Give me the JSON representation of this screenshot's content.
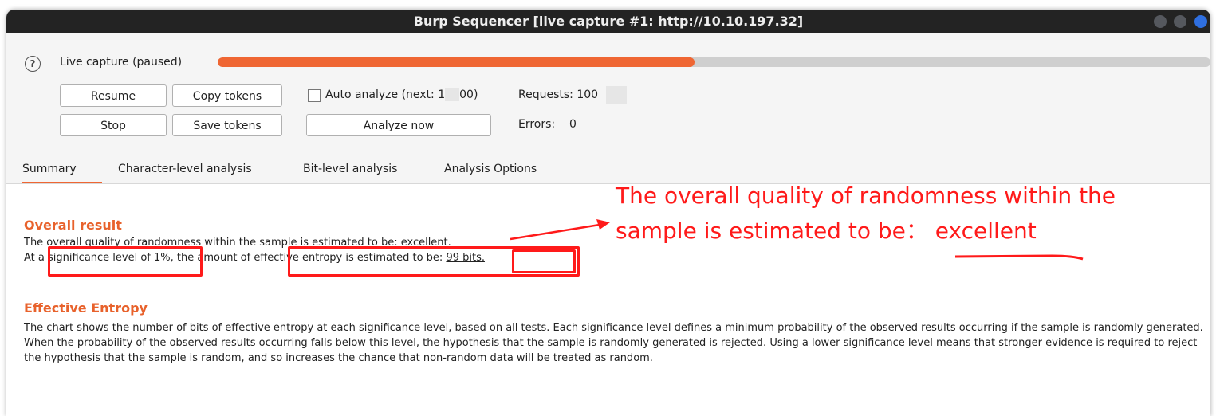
{
  "window": {
    "title": "Burp Sequencer [live capture #1: http://10.10.197.32]"
  },
  "capture": {
    "status": "Live capture (paused)",
    "progress_fraction": 0.48
  },
  "buttons": {
    "resume": "Resume",
    "copy_tokens": "Copy tokens",
    "stop": "Stop",
    "save_tokens": "Save tokens",
    "analyze_now": "Analyze now"
  },
  "auto_analyze": {
    "label": "Auto analyze (next: 1",
    "label_end": "00)",
    "checked": false
  },
  "requests": {
    "label": "Requests:",
    "value": "100"
  },
  "errors": {
    "label": "Errors:",
    "value": "0"
  },
  "tabs": [
    {
      "label": "Summary",
      "active": true
    },
    {
      "label": "Character-level analysis",
      "active": false
    },
    {
      "label": "Bit-level analysis",
      "active": false
    },
    {
      "label": "Analysis Options",
      "active": false
    }
  ],
  "overall": {
    "heading": "Overall result",
    "line1": "The overall quality of randomness within the sample is estimated to be: excellent.",
    "line2_prefix": "At a ",
    "significance": "significance level of 1%",
    "line2_middle": ", the amount of ",
    "entropy_text": "effective entropy is estimated to be: ",
    "bits": "99 bits."
  },
  "effective_entropy": {
    "heading": "Effective Entropy",
    "text": "The chart shows the number of bits of effective entropy at each significance level, based on all tests. Each significance level defines a minimum probability of the observed results occurring if the sample is randomly generated. When the probability of the observed results occurring falls below this level, the hypothesis that the sample is randomly generated is rejected. Using a lower significance level means that stronger evidence is required to reject the hypothesis that the sample is random, and so increases the chance that non-random data will be treated as random."
  },
  "annotation": {
    "line1": "The overall quality of randomness within the",
    "line2": "sample is estimated to be： excellent",
    "color": "#ff1a1a"
  },
  "colors": {
    "accent": "#ef6633",
    "heading": "#e8622c",
    "title_bar": "#232323"
  }
}
